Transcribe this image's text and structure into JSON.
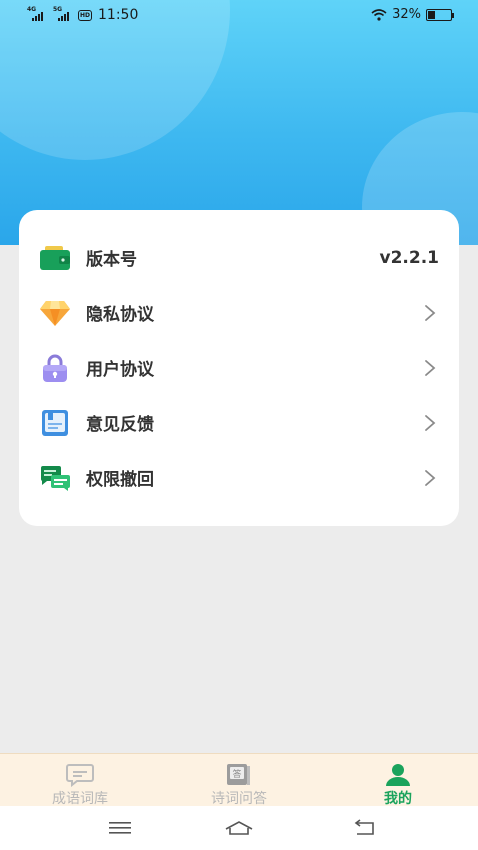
{
  "status_bar": {
    "net1": "4G",
    "net2": "5G",
    "hd": "HD",
    "time": "11:50",
    "battery_percent": "32%",
    "battery_level": 0.32
  },
  "menu": {
    "items": [
      {
        "label": "版本号",
        "value": "v2.2.1",
        "icon": "wallet-icon"
      },
      {
        "label": "隐私协议",
        "icon": "diamond-icon"
      },
      {
        "label": "用户协议",
        "icon": "lock-icon"
      },
      {
        "label": "意见反馈",
        "icon": "feedback-book-icon"
      },
      {
        "label": "权限撤回",
        "icon": "chat-bubbles-icon"
      }
    ]
  },
  "tabs": [
    {
      "label": "成语词库",
      "icon": "message-icon",
      "active": false
    },
    {
      "label": "诗词问答",
      "icon": "answer-book-icon",
      "active": false
    },
    {
      "label": "我的",
      "icon": "user-icon",
      "active": true
    }
  ],
  "colors": {
    "accent_green": "#1aa35c",
    "header_blue": "#3eb8f0",
    "tabbar_bg": "#fdf2e2"
  },
  "system_nav": [
    "menu-icon",
    "home-icon",
    "back-icon"
  ]
}
